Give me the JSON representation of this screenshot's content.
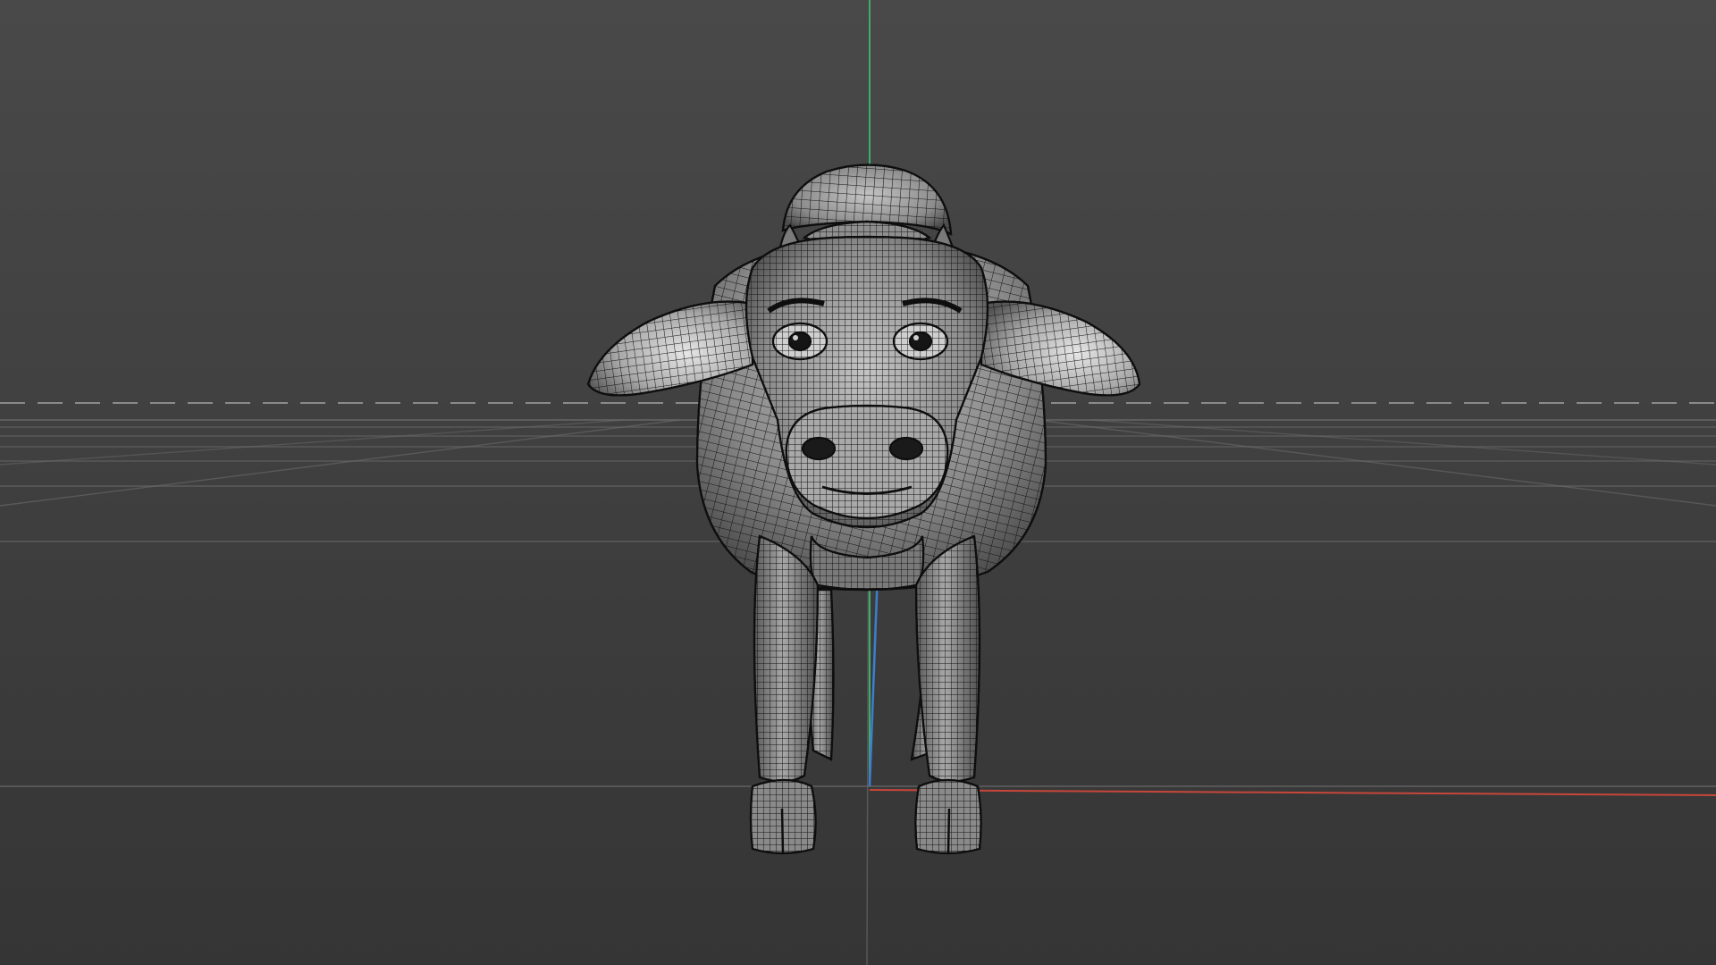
{
  "viewport": {
    "background_top": "#494949",
    "background_bottom": "#353535",
    "grid_color": "#6a6a6a",
    "horizon_dash_color": "#8a8a8a",
    "axis_colors": {
      "x": "#c8463a",
      "y": "#3fae6b",
      "z": "#3a7fd0"
    },
    "model": {
      "name": "cow",
      "display_mode": "wireframe",
      "mesh_fill": "#9a9a9a",
      "mesh_shadow": "#3c3c3c",
      "wire_color": "#141414"
    }
  }
}
